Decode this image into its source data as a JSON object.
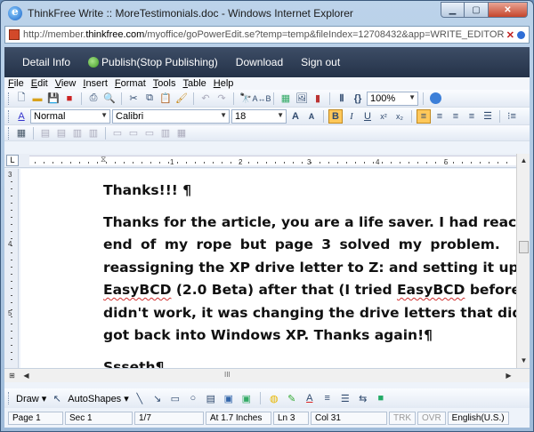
{
  "window": {
    "title": "ThinkFree Write :: MoreTestimonials.doc - Windows Internet Explorer",
    "minimize_glyph": "▁",
    "maximize_glyph": "▢",
    "close_glyph": "✕"
  },
  "address": {
    "url_prefix": "http://member.",
    "url_domain": "thinkfree.com",
    "url_rest": "/myoffice/goPowerEdit.se?temp=temp&fileIndex=12708432&app=WRITE_EDITOR"
  },
  "app_nav": {
    "detail_info": "Detail Info",
    "publish": "Publish(Stop Publishing)",
    "download": "Download",
    "sign_out": "Sign out"
  },
  "menu": [
    "File",
    "Edit",
    "View",
    "Insert",
    "Format",
    "Tools",
    "Table",
    "Help"
  ],
  "toolbar1": {
    "zoom": "100%"
  },
  "toolbar2": {
    "style": "Normal",
    "font": "Calibri",
    "size": "18",
    "bold": "B",
    "italic": "I",
    "underline": "U",
    "superscript": "x²",
    "subscript": "x₂",
    "grow_font": "A",
    "shrink_font": "A"
  },
  "ruler": {
    "corner": "L",
    "numbers": [
      "1",
      "2",
      "3",
      "4",
      "5"
    ],
    "v_numbers": [
      "3",
      "4",
      "5"
    ]
  },
  "document": {
    "title": "Thanks!!! ¶",
    "body_lines": [
      "Thanks for the article, you are a life saver. I had reache",
      "end  of  my  rope  but  page  3  solved  my  problem.",
      "reassigning the XP drive letter to Z: and setting it up wit",
      "(2.0 Beta) after that (I tried",
      "didn't work, it was changing the drive letters that did it) I",
      "got back into Windows XP. Thanks again!¶"
    ],
    "easybcd": "EasyBCD",
    "line4_tail": "before a",
    "signature": "Ssseth¶"
  },
  "scroll": {
    "up": "▲",
    "down": "▼",
    "left": "◀",
    "right": "▶",
    "grip": "III"
  },
  "drawbar": {
    "draw": "Draw ▾",
    "autoshapes": "AutoShapes ▾"
  },
  "status": {
    "page": "Page 1",
    "section": "Sec 1",
    "page_of": "1/7",
    "position": "At 1.7 Inches",
    "line": "Ln 3",
    "column": "Col 31",
    "trk": "TRK",
    "ovr": "OVR",
    "language": "English(U.S.)"
  }
}
